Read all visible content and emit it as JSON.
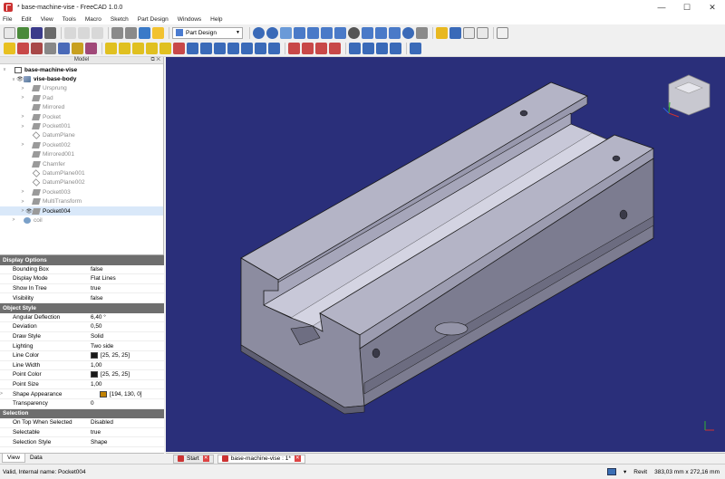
{
  "window": {
    "title": "* base-machine-vise - FreeCAD 1.0.0",
    "minimize": "—",
    "maximize": "☐",
    "close": "✕"
  },
  "menu": [
    "File",
    "Edit",
    "View",
    "Tools",
    "Macro",
    "Sketch",
    "Part Design",
    "Windows",
    "Help"
  ],
  "workbench": {
    "selected": "Part Design"
  },
  "model_panel": {
    "title": "Model",
    "header_buttons": "⧉ ✕"
  },
  "tree": [
    {
      "label": "base-machine-vise",
      "level": 0,
      "icon": "document-icon",
      "expand": "v"
    },
    {
      "label": "vise-base-body",
      "level": 1,
      "icon": "body-icon",
      "expand": "v",
      "eye": "👁"
    },
    {
      "label": "Ursprung",
      "level": 2,
      "icon": "origin-icon",
      "expand": ">"
    },
    {
      "label": "Pad",
      "level": 2,
      "icon": "pad-icon",
      "expand": ">"
    },
    {
      "label": "Mirrored",
      "level": 2,
      "icon": "mirrored-icon",
      "expand": ""
    },
    {
      "label": "Pocket",
      "level": 2,
      "icon": "pocket-icon",
      "expand": ">"
    },
    {
      "label": "Pocket001",
      "level": 2,
      "icon": "pocket-icon",
      "expand": ">"
    },
    {
      "label": "DatumPlane",
      "level": 2,
      "icon": "datum-plane-icon",
      "expand": ""
    },
    {
      "label": "Pocket002",
      "level": 2,
      "icon": "pocket-icon",
      "expand": ">"
    },
    {
      "label": "Mirrored001",
      "level": 2,
      "icon": "mirrored-icon",
      "expand": ""
    },
    {
      "label": "Chamfer",
      "level": 2,
      "icon": "chamfer-icon",
      "expand": ""
    },
    {
      "label": "DatumPlane001",
      "level": 2,
      "icon": "datum-plane-icon",
      "expand": ""
    },
    {
      "label": "DatumPlane002",
      "level": 2,
      "icon": "datum-plane-icon",
      "expand": ""
    },
    {
      "label": "Pocket003",
      "level": 2,
      "icon": "pocket-icon",
      "expand": ">"
    },
    {
      "label": "MultiTransform",
      "level": 2,
      "icon": "multitransform-icon",
      "expand": ">"
    },
    {
      "label": "Pocket004",
      "level": 2,
      "icon": "pocket-icon",
      "expand": ">",
      "eye": "👁",
      "selected": true
    },
    {
      "label": "coil",
      "level": 1,
      "icon": "coil-icon",
      "expand": ">"
    }
  ],
  "properties": [
    {
      "group": "Display Options"
    },
    {
      "key": "Bounding Box",
      "value": "false"
    },
    {
      "key": "Display Mode",
      "value": "Flat Lines"
    },
    {
      "key": "Show In Tree",
      "value": "true"
    },
    {
      "key": "Visibility",
      "value": "false"
    },
    {
      "group": "Object Style"
    },
    {
      "key": "Angular Deflection",
      "value": "6,40 °"
    },
    {
      "key": "Deviation",
      "value": "0,50"
    },
    {
      "key": "Draw Style",
      "value": "Solid"
    },
    {
      "key": "Lighting",
      "value": "Two side"
    },
    {
      "key": "Line Color",
      "value": "[25, 25, 25]",
      "swatch": "#191919"
    },
    {
      "key": "Line Width",
      "value": "1,00"
    },
    {
      "key": "Point Color",
      "value": "[25, 25, 25]",
      "swatch": "#191919"
    },
    {
      "key": "Point Size",
      "value": "1,00"
    },
    {
      "key": "Shape Appearance",
      "value": "[194, 130, 0]",
      "swatch": "#c28200",
      "expand": ">"
    },
    {
      "key": "Transparency",
      "value": "0"
    },
    {
      "group": "Selection"
    },
    {
      "key": "On Top When Selected",
      "value": "Disabled"
    },
    {
      "key": "Selectable",
      "value": "true"
    },
    {
      "key": "Selection Style",
      "value": "Shape"
    }
  ],
  "property_tabs": [
    "View",
    "Data"
  ],
  "view_tabs": [
    {
      "label": "Start",
      "close": "✕"
    },
    {
      "label": "base-machine-vise : 1*",
      "close": "✕",
      "active": true
    }
  ],
  "status": {
    "message": "Valid, Internal name: Pocket004",
    "nav_style": "Revit",
    "dimensions": "383,03 mm x 272,16 mm",
    "dropdown": "▾"
  },
  "colors": {
    "viewport_bg": "#2a2f7a",
    "part_top": "#b4b4c6",
    "part_side": "#8f8fa3",
    "part_front": "#76768a"
  }
}
